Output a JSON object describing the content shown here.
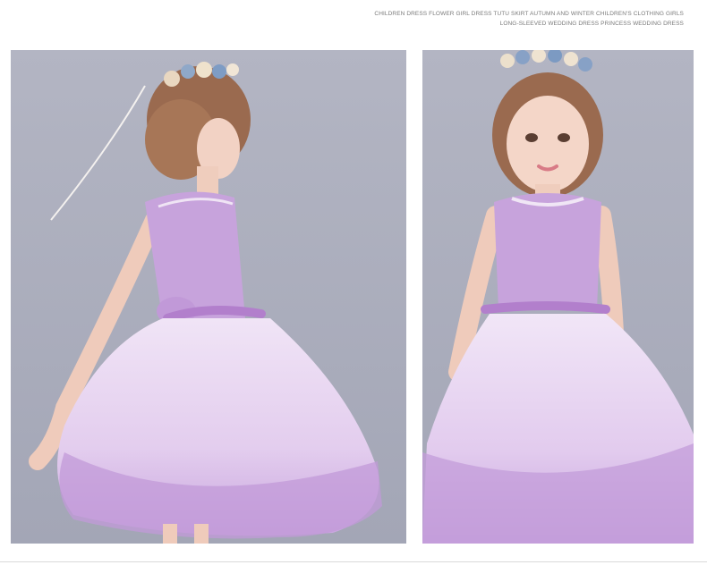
{
  "caption": {
    "line1": "CHILDREN DRESS FLOWER GIRL DRESS TUTU SKIRT AUTUMN AND WINTER CHILDREN'S CLOTHING GIRLS",
    "line2": "LONG-SLEEVED WEDDING DRESS PRINCESS WEDDING DRESS"
  },
  "colors": {
    "backdrop": "#a9acbb",
    "dress_bodice": "#c7a3dc",
    "dress_skirt": "#ead9f2",
    "lace": "#b58dd0",
    "skin": "#f2d2c4",
    "hair": "#9a6a4f"
  }
}
